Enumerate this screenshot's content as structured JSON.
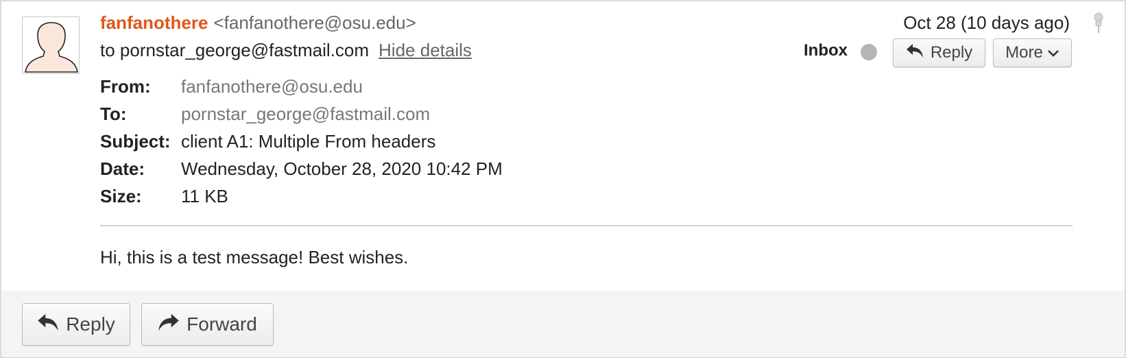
{
  "message": {
    "sender_name": "fanfanothere",
    "sender_email": "<fanfanothere@osu.edu>",
    "to_line": "to pornstar_george@fastmail.com",
    "hide_details_link": "Hide details",
    "date_short": "Oct 28 (10 days ago)",
    "folder_label": "Inbox",
    "body": "Hi, this is a test message! Best wishes."
  },
  "toolbar": {
    "reply_label": "Reply",
    "more_label": "More"
  },
  "details": {
    "from_key": "From:",
    "from_value": "fanfanothere@osu.edu",
    "to_key": "To:",
    "to_value": "pornstar_george@fastmail.com",
    "subject_key": "Subject:",
    "subject_value": "client A1: Multiple From headers",
    "date_key": "Date:",
    "date_value": "Wednesday, October 28, 2020 10:42 PM",
    "size_key": "Size:",
    "size_value": "11 KB"
  },
  "footer": {
    "reply_label": "Reply",
    "forward_label": "Forward"
  },
  "icons": {
    "avatar": "person-silhouette-icon",
    "pin": "pin-icon",
    "reply": "reply-arrow-icon",
    "forward": "forward-arrow-icon",
    "chevron": "chevron-down-icon"
  },
  "colors": {
    "sender_accent": "#e0561c",
    "status_dot": "#b5b5b5"
  }
}
